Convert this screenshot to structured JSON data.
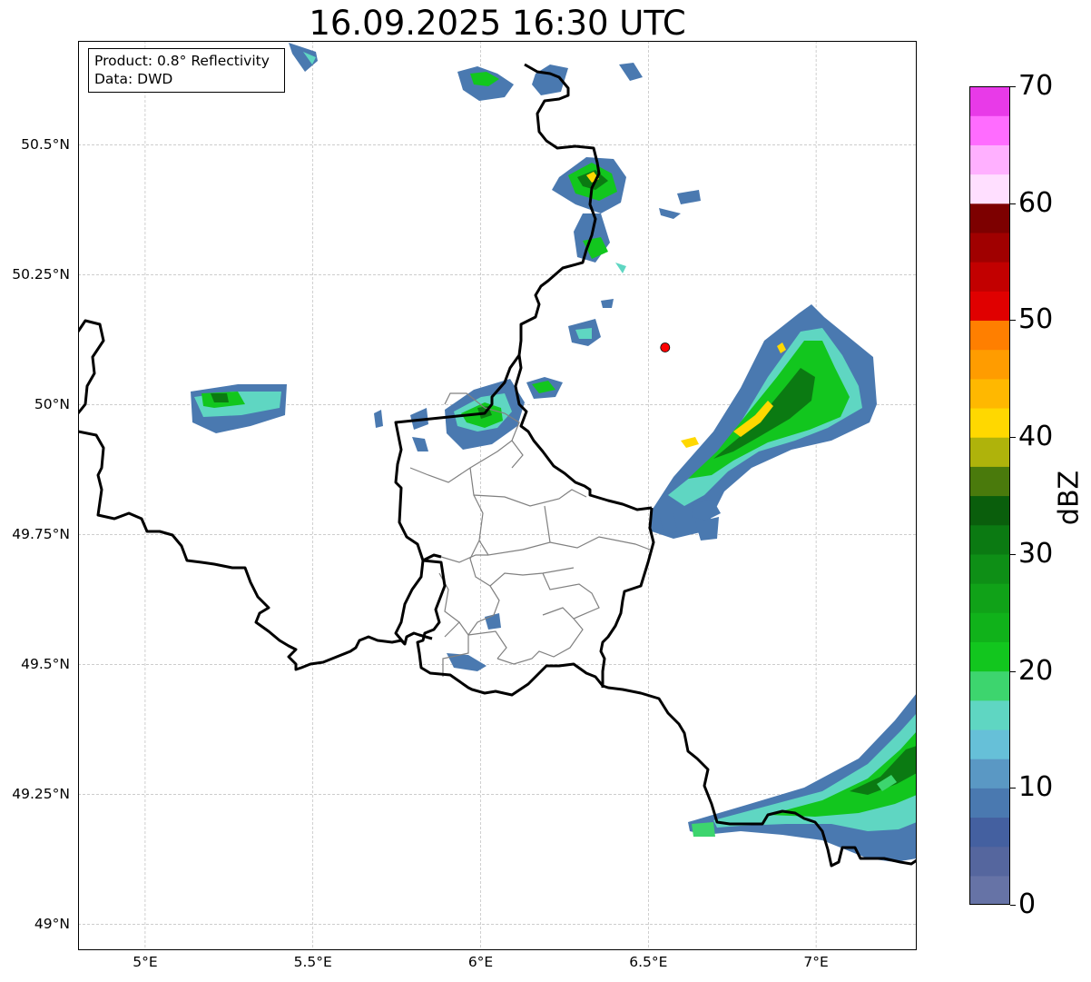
{
  "title": "16.09.2025 16:30 UTC",
  "info": {
    "line1": "Product: 0.8° Reflectivity",
    "line2": "Data: DWD"
  },
  "map": {
    "lon_range": [
      4.8,
      7.3
    ],
    "lat_range": [
      48.95,
      50.7
    ],
    "lat_ticks": [
      {
        "value": 50.5,
        "label": "50.5°N"
      },
      {
        "value": 50.25,
        "label": "50.25°N"
      },
      {
        "value": 50.0,
        "label": "50°N"
      },
      {
        "value": 49.75,
        "label": "49.75°N"
      },
      {
        "value": 49.5,
        "label": "49.5°N"
      },
      {
        "value": 49.25,
        "label": "49.25°N"
      },
      {
        "value": 49.0,
        "label": "49°N"
      }
    ],
    "lon_ticks": [
      {
        "value": 5.0,
        "label": "5°E"
      },
      {
        "value": 5.5,
        "label": "5.5°E"
      },
      {
        "value": 6.0,
        "label": "6°E"
      },
      {
        "value": 6.5,
        "label": "6.5°E"
      },
      {
        "value": 7.0,
        "label": "7°E"
      }
    ],
    "grid": true,
    "radar_site": {
      "lon": 6.55,
      "lat": 50.11,
      "color": "#ff0000"
    }
  },
  "colorbar": {
    "label": "dBZ",
    "min": 0,
    "max": 70,
    "ticks": [
      "0",
      "10",
      "20",
      "30",
      "40",
      "50",
      "60",
      "70"
    ],
    "colors": [
      "#6673a6",
      "#55669e",
      "#4460a0",
      "#4a79b0",
      "#5a98c4",
      "#66c0d8",
      "#5fd6c2",
      "#3dd56e",
      "#12c61e",
      "#10b21a",
      "#10a218",
      "#0e8f16",
      "#0b7a12",
      "#0a5e0c",
      "#4a7a0c",
      "#afb30b",
      "#ffd800",
      "#ffb800",
      "#ff9c00",
      "#ff7f00",
      "#e00000",
      "#c20000",
      "#a00000",
      "#7d0000",
      "#ffdfff",
      "#ffb0ff",
      "#ff6cff",
      "#e83ae8"
    ]
  }
}
